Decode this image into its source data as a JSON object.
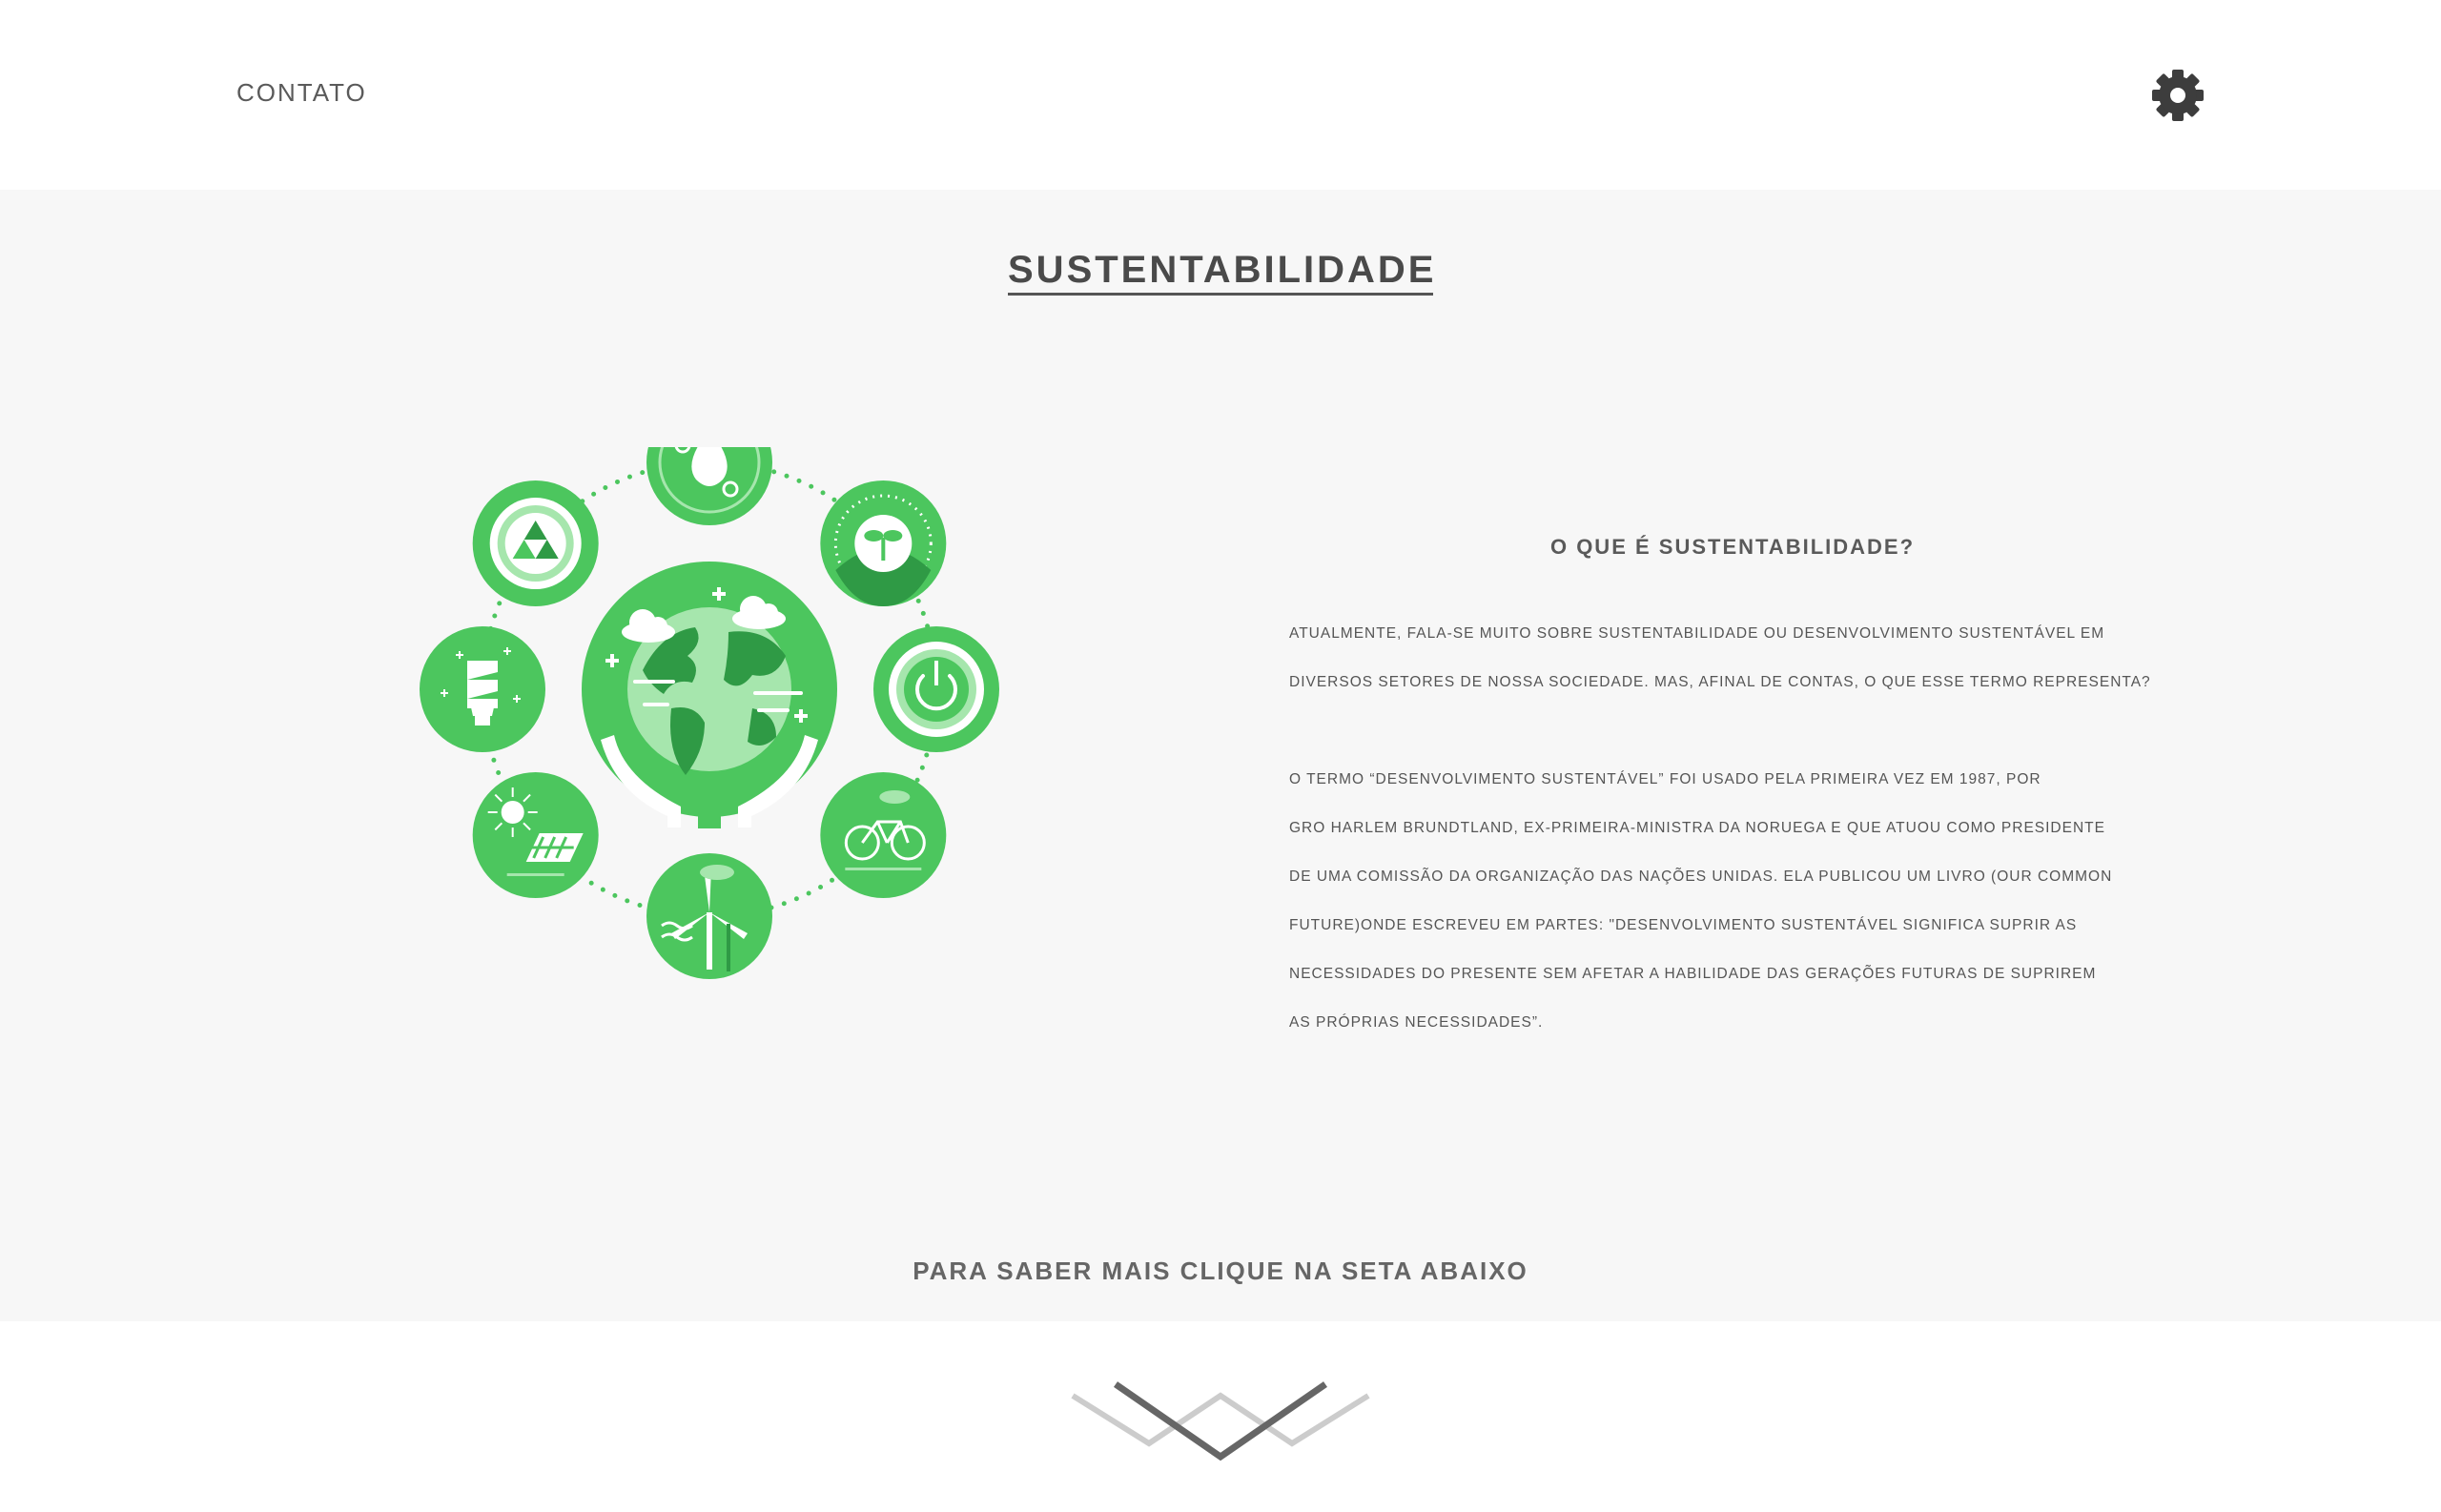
{
  "nav": {
    "contact_label": "CONTATO"
  },
  "main": {
    "title": "SUSTENTABILIDADE",
    "section_heading": "O QUE É SUSTENTABILIDADE?",
    "paragraph1": [
      "ATUALMENTE, FALA-SE MUITO SOBRE SUSTENTABILIDADE OU DESENVOLVIMENTO SUSTENTÁVEL EM",
      "DIVERSOS SETORES DE NOSSA SOCIEDADE. MAS, AFINAL DE CONTAS, O QUE ESSE TERMO REPRESENTA?"
    ],
    "paragraph2": [
      "O TERMO “DESENVOLVIMENTO SUSTENTÁVEL” FOI USADO PELA PRIMEIRA VEZ EM 1987, POR",
      "GRO HARLEM BRUNDTLAND, EX-PRIMEIRA-MINISTRA DA NORUEGA E QUE ATUOU COMO PRESIDENTE",
      "DE UMA COMISSÃO DA ORGANIZAÇÃO DAS NAÇÕES UNIDAS. ELA PUBLICOU UM LIVRO (OUR COMMON",
      "FUTURE)ONDE ESCREVEU EM PARTES: \"DESENVOLVIMENTO SUSTENTÁVEL SIGNIFICA SUPRIR AS",
      "NECESSIDADES DO PRESENTE SEM AFETAR A HABILIDADE DAS GERAÇÕES FUTURAS DE SUPRIREM",
      "AS PRÓPRIAS NECESSIDADES”."
    ],
    "cta": "PARA SABER MAIS CLIQUE NA SETA ABAIXO"
  },
  "colors": {
    "green": "#4cc65e",
    "green_light": "#a6e6ad",
    "green_dark": "#2f9a45",
    "text": "#555555",
    "band": "#f7f7f7"
  },
  "icons": {
    "settings": "gear-icon",
    "illustration": [
      "globe-hands-icon",
      "water-drop-icon",
      "sprout-icon",
      "power-icon",
      "bicycle-icon",
      "wind-turbine-icon",
      "solar-panel-icon",
      "light-bulb-icon",
      "recycle-icon"
    ],
    "scroll": "chevron-down-icon"
  }
}
